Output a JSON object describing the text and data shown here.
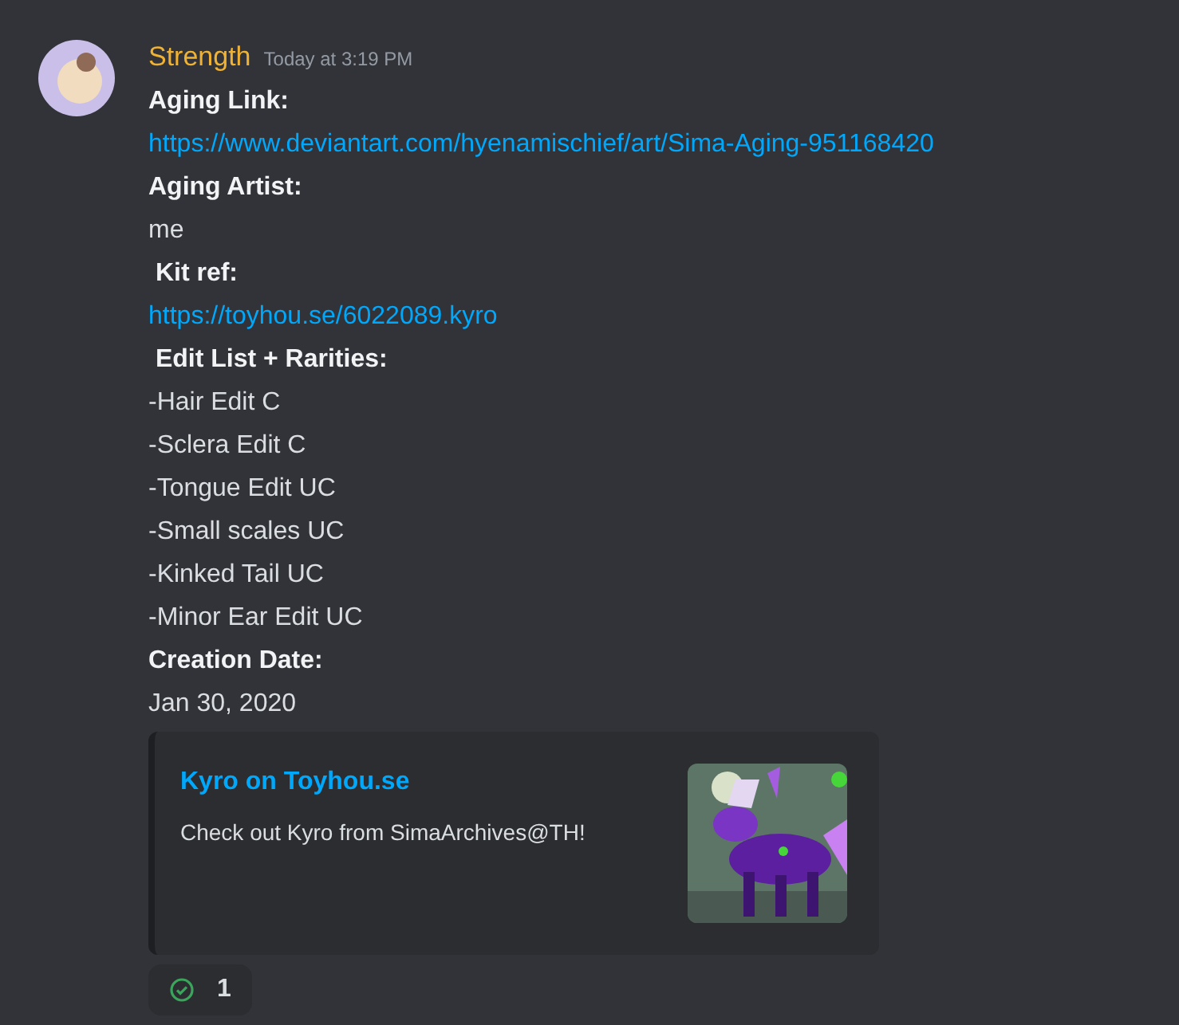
{
  "message": {
    "author": "Strength",
    "timestamp": "Today at 3:19 PM",
    "lines": [
      {
        "kind": "heading",
        "text": "Aging Link:"
      },
      {
        "kind": "link",
        "text": "https://www.deviantart.com/hyenamischief/art/Sima-Aging-951168420"
      },
      {
        "kind": "heading",
        "text": "Aging Artist:"
      },
      {
        "kind": "plain",
        "text": "me"
      },
      {
        "kind": "heading",
        "text": " Kit ref:"
      },
      {
        "kind": "link",
        "text": "https://toyhou.se/6022089.kyro"
      },
      {
        "kind": "heading",
        "text": " Edit List + Rarities:"
      },
      {
        "kind": "plain",
        "text": "-Hair Edit C"
      },
      {
        "kind": "plain",
        "text": "-Sclera Edit C"
      },
      {
        "kind": "plain",
        "text": "-Tongue Edit UC"
      },
      {
        "kind": "plain",
        "text": "-Small scales UC"
      },
      {
        "kind": "plain",
        "text": "-Kinked Tail UC"
      },
      {
        "kind": "plain",
        "text": "-Minor Ear Edit UC"
      },
      {
        "kind": "heading",
        "text": "Creation Date:"
      },
      {
        "kind": "plain",
        "text": "Jan 30, 2020"
      }
    ],
    "embed": {
      "title": "Kyro on Toyhou.se",
      "description": "Check out Kyro from SimaArchives@TH!"
    },
    "reactions": [
      {
        "count": "1",
        "selected": false
      }
    ]
  }
}
